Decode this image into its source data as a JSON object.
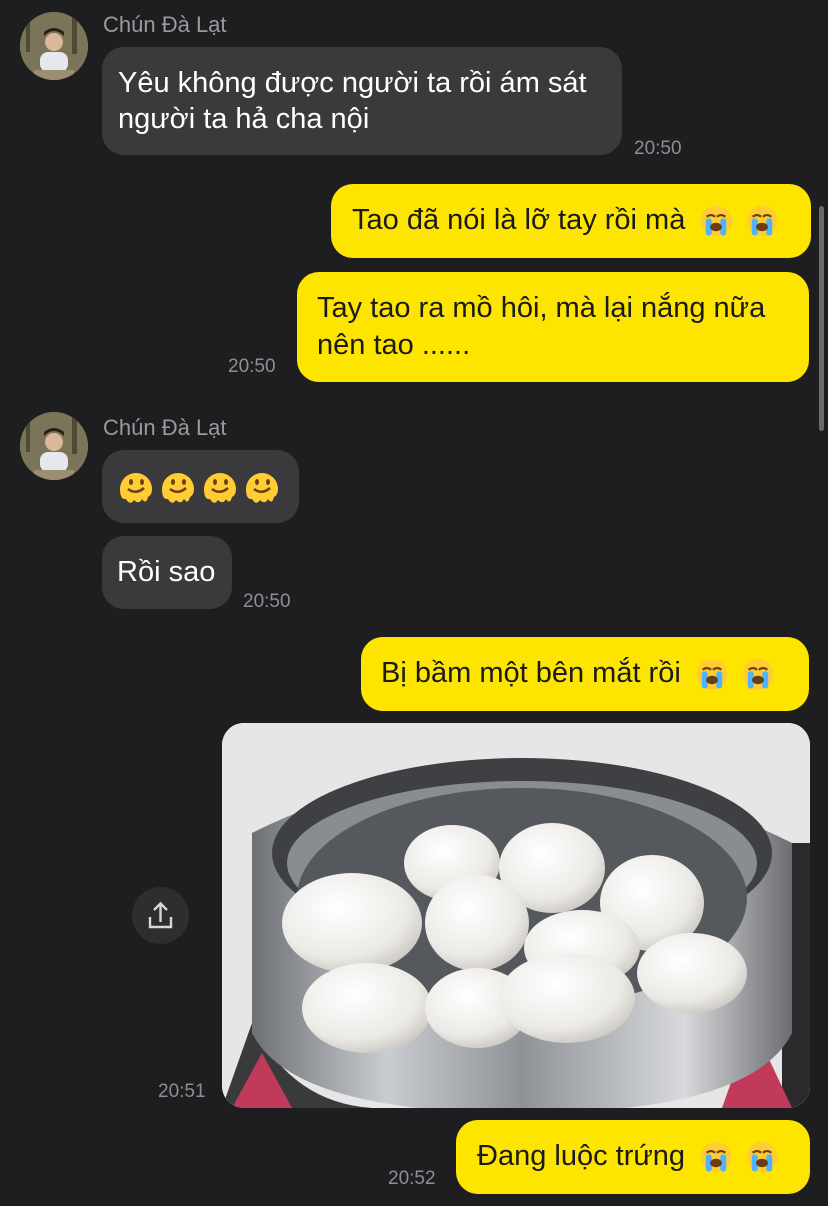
{
  "sender_name": "Chún Đà Lạt",
  "messages": {
    "m1": {
      "text": "Yêu không được người ta rồi ám sát người ta hả cha nội",
      "time": "20:50"
    },
    "m2": {
      "text": "Tao đã nói là lỡ tay rồi mà"
    },
    "m3": {
      "text": "Tay tao ra mồ hôi, mà lại nắng nữa nên tao ......",
      "time": "20:50"
    },
    "m4": {
      "emoji": "melting-face-emoji x4"
    },
    "m5": {
      "text": "Rồi sao",
      "time": "20:50"
    },
    "m6": {
      "text": "Bị bầm một bên mắt rồi"
    },
    "m7": {
      "image": "pot-of-boiled-eggs-photo",
      "time": "20:51"
    },
    "m8": {
      "text": "Đang luộc trứng",
      "time": "20:52"
    }
  },
  "colors": {
    "background": "#1e1e20",
    "incoming_bubble": "#3a3a3c",
    "outgoing_bubble": "#fee500"
  },
  "icons": [
    "crying-face-emoji",
    "melting-face-emoji",
    "share-icon"
  ]
}
